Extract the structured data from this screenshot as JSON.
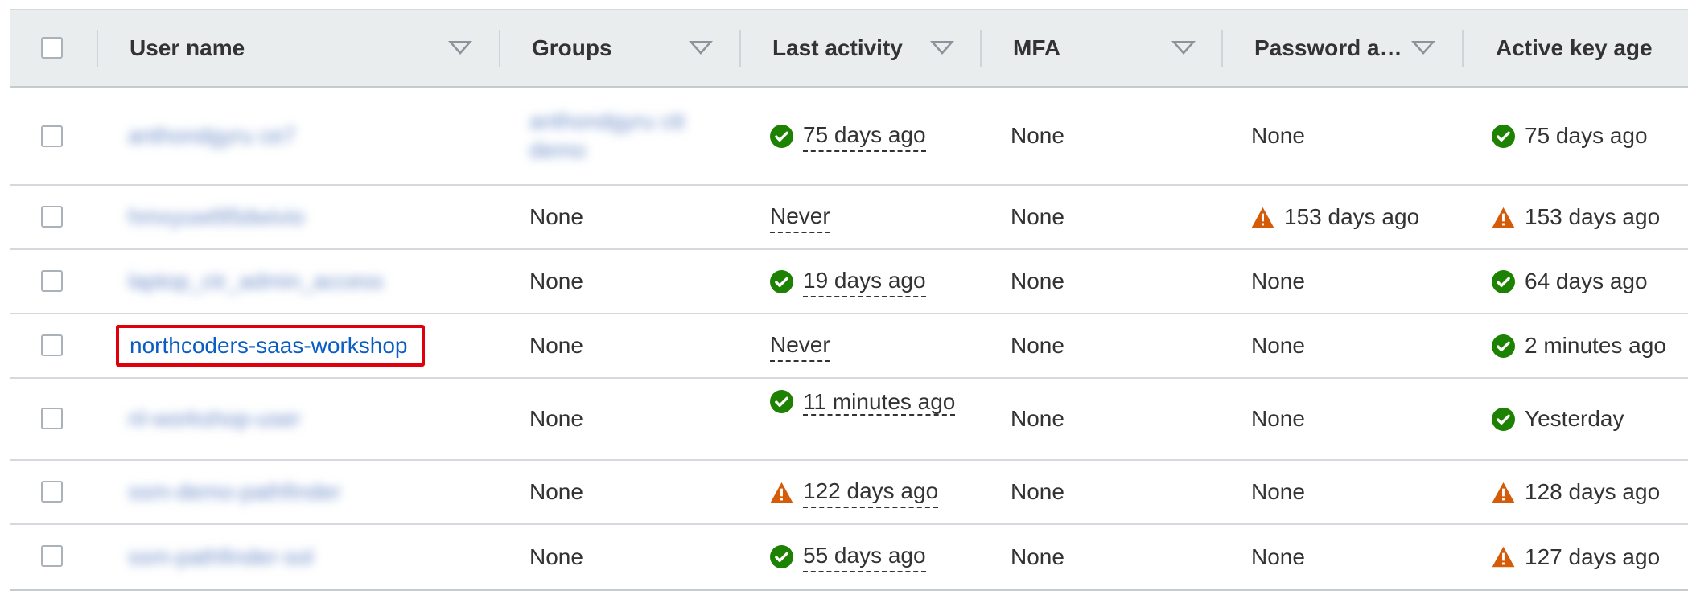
{
  "table": {
    "columns": [
      {
        "label": "User name",
        "sortable": true
      },
      {
        "label": "Groups",
        "sortable": true
      },
      {
        "label": "Last activity",
        "sortable": true
      },
      {
        "label": "MFA",
        "sortable": true
      },
      {
        "label": "Password a…",
        "sortable": true
      },
      {
        "label": "Active key age",
        "sortable": false
      }
    ],
    "status_colors": {
      "ok": "#1d8102",
      "warning": "#d45b07",
      "link": "#0b5cc4",
      "highlight": "#e0000b"
    },
    "rows": [
      {
        "user_name": "anthondgyru ce7",
        "user_blurred": true,
        "groups": "anthondgyru ctt demo",
        "groups_blurred": true,
        "last_activity": {
          "text": "75 days ago",
          "icon": "check-circle-icon"
        },
        "mfa": "None",
        "password_age": {
          "text": "None",
          "icon": null
        },
        "active_key_age": {
          "text": "75 days ago",
          "icon": "check-circle-icon"
        }
      },
      {
        "user_name": "hmxyuwt95dwivio",
        "user_blurred": true,
        "groups": "None",
        "groups_blurred": false,
        "last_activity": {
          "text": "Never",
          "icon": null
        },
        "mfa": "None",
        "password_age": {
          "text": "153 days ago",
          "icon": "warning-triangle-icon"
        },
        "active_key_age": {
          "text": "153 days ago",
          "icon": "warning-triangle-icon"
        }
      },
      {
        "user_name": "laptop_ctr_admin_access",
        "user_blurred": true,
        "groups": "None",
        "groups_blurred": false,
        "last_activity": {
          "text": "19 days ago",
          "icon": "check-circle-icon"
        },
        "mfa": "None",
        "password_age": {
          "text": "None",
          "icon": null
        },
        "active_key_age": {
          "text": "64 days ago",
          "icon": "check-circle-icon"
        }
      },
      {
        "user_name": "northcoders-saas-workshop",
        "user_blurred": false,
        "highlighted": true,
        "groups": "None",
        "groups_blurred": false,
        "last_activity": {
          "text": "Never",
          "icon": null
        },
        "mfa": "None",
        "password_age": {
          "text": "None",
          "icon": null
        },
        "active_key_age": {
          "text": "2 minutes ago",
          "icon": "check-circle-icon"
        }
      },
      {
        "user_name": "nl-workshop-user",
        "user_blurred": true,
        "groups": "None",
        "groups_blurred": false,
        "last_activity": {
          "text": "11 minutes ago",
          "icon": "check-circle-icon"
        },
        "mfa": "None",
        "password_age": {
          "text": "None",
          "icon": null
        },
        "active_key_age": {
          "text": "Yesterday",
          "icon": "check-circle-icon"
        }
      },
      {
        "user_name": "ssm-demo-pathfinder",
        "user_blurred": true,
        "groups": "None",
        "groups_blurred": false,
        "last_activity": {
          "text": "122 days ago",
          "icon": "warning-triangle-icon"
        },
        "mfa": "None",
        "password_age": {
          "text": "None",
          "icon": null
        },
        "active_key_age": {
          "text": "128 days ago",
          "icon": "warning-triangle-icon"
        }
      },
      {
        "user_name": "ssm-pathfinder-sol",
        "user_blurred": true,
        "groups": "None",
        "groups_blurred": false,
        "last_activity": {
          "text": "55 days ago",
          "icon": "check-circle-icon"
        },
        "mfa": "None",
        "password_age": {
          "text": "None",
          "icon": null
        },
        "active_key_age": {
          "text": "127 days ago",
          "icon": "warning-triangle-icon"
        }
      }
    ]
  }
}
